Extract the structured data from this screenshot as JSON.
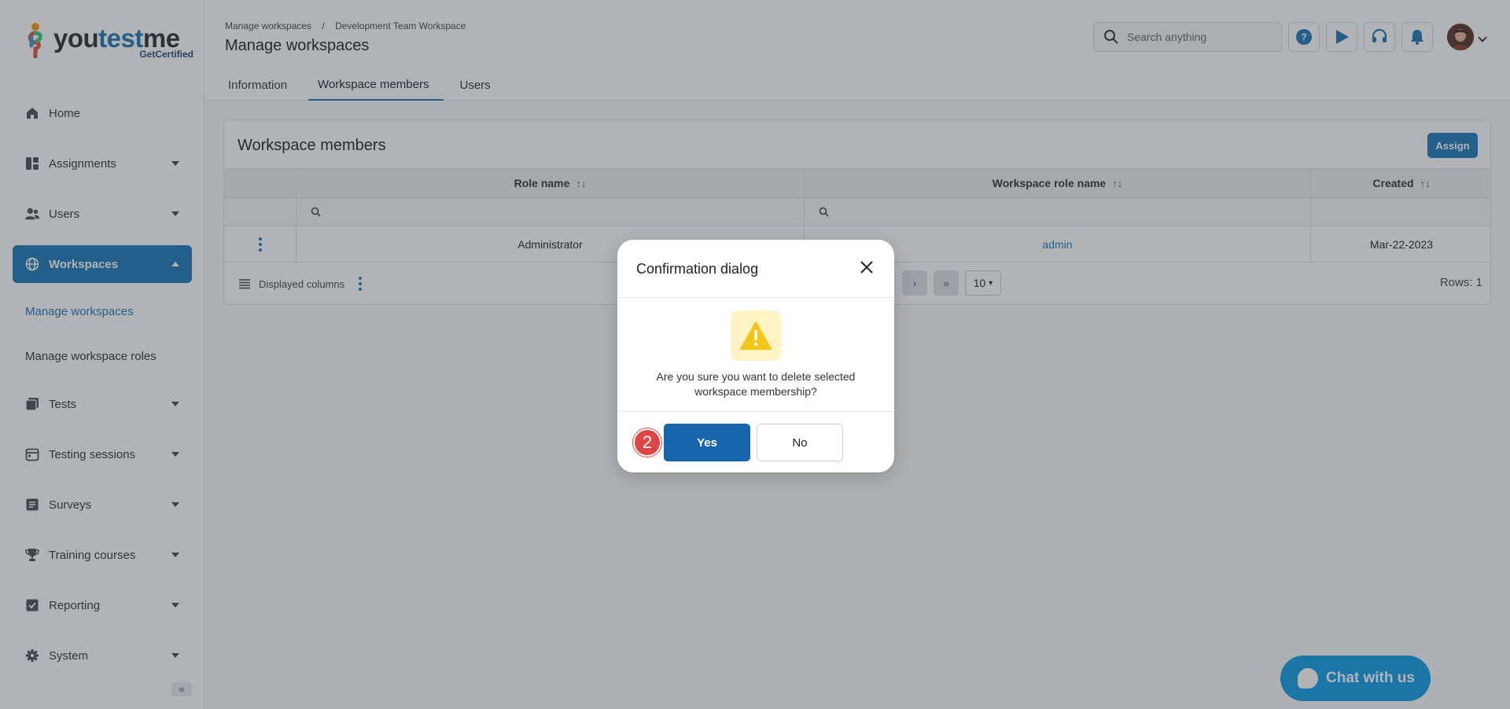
{
  "brand": {
    "you": "you",
    "test": "test",
    "me": "me",
    "sub": "GetCertified"
  },
  "sidebar": {
    "items": [
      {
        "label": "Home",
        "icon": "home-icon"
      },
      {
        "label": "Assignments",
        "icon": "assignments-icon"
      },
      {
        "label": "Users",
        "icon": "users-icon"
      },
      {
        "label": "Workspaces",
        "icon": "globe-icon"
      },
      {
        "label": "Tests",
        "icon": "tests-icon"
      },
      {
        "label": "Testing sessions",
        "icon": "calendar-icon"
      },
      {
        "label": "Surveys",
        "icon": "surveys-icon"
      },
      {
        "label": "Training courses",
        "icon": "trophy-icon"
      },
      {
        "label": "Reporting",
        "icon": "reporting-icon"
      },
      {
        "label": "System",
        "icon": "gear-icon"
      }
    ],
    "sub_items": [
      {
        "label": "Manage workspaces"
      },
      {
        "label": "Manage workspace roles"
      }
    ],
    "collapse": "«"
  },
  "header": {
    "breadcrumb": [
      "Manage workspaces",
      "/",
      "Development Team Workspace"
    ],
    "title": "Manage workspaces",
    "tabs": [
      "Information",
      "Workspace members",
      "Users"
    ],
    "search_placeholder": "Search anything"
  },
  "card": {
    "title": "Workspace members",
    "assign_label": "Assign",
    "columns": [
      "Role name",
      "Workspace role name",
      "Created"
    ],
    "sort_glyph": "↑↓",
    "rows": [
      {
        "role_name": "Administrator",
        "workspace_role": "admin",
        "created": "Mar-22-2023"
      }
    ],
    "displayed_columns_label": "Displayed columns",
    "page_size": "10",
    "rows_label": "Rows: 1"
  },
  "dialog": {
    "title": "Confirmation dialog",
    "message": "Are you sure you want to delete selected workspace membership?",
    "yes_label": "Yes",
    "no_label": "No",
    "step": "2"
  },
  "chat": {
    "label": "Chat with us"
  },
  "colors": {
    "primary": "#1b78b8",
    "dialog_yes": "#1766ac",
    "badge": "#e04545",
    "chat": "#0e9be8",
    "warning": "#f5c518"
  }
}
